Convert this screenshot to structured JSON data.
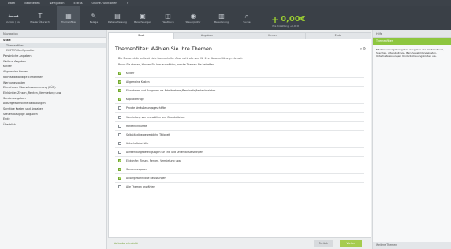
{
  "menu": [
    "Datei",
    "Bearbeiten",
    "Navigation",
    "Extras",
    "Online-Funktionen",
    "?"
  ],
  "toolbar": {
    "items": [
      {
        "icon": "back-forward-icon",
        "glyph": "←→",
        "label": "zurück / vor"
      },
      {
        "icon": "text-icon",
        "glyph": "T",
        "label": "Wieder Übersicht"
      },
      {
        "icon": "filter-icon",
        "glyph": "▦",
        "label": "Themenfilter"
      },
      {
        "icon": "edit-icon",
        "glyph": "✎",
        "label": "Belege"
      },
      {
        "icon": "document-icon",
        "glyph": "▤",
        "label": "Datenerfassung"
      },
      {
        "icon": "calculator-icon",
        "glyph": "▣",
        "label": "Berechnungen"
      },
      {
        "icon": "book-icon",
        "glyph": "◫",
        "label": "Handbuch"
      },
      {
        "icon": "eye-icon",
        "glyph": "◉",
        "label": "Steuerprüfer"
      },
      {
        "icon": "form-icon",
        "glyph": "▥",
        "label": "Berechnung"
      },
      {
        "icon": "search-icon",
        "glyph": "⌕",
        "label": "Suche"
      }
    ],
    "amount_sign": "+",
    "amount_value": "0,00€",
    "amount_sub": "Ihre Erstattung: +0,00 €"
  },
  "leftnav": {
    "title": "Navigation",
    "items": [
      {
        "label": "Start",
        "level": 0,
        "strong": true,
        "selected": false
      },
      {
        "label": "Themenfilter",
        "level": 1,
        "strong": false,
        "selected": true
      },
      {
        "label": "ELSTER-Konfiguration",
        "level": 1,
        "strong": false,
        "selected": false
      },
      {
        "label": "Persönliche Angaben",
        "level": 0,
        "strong": false,
        "selected": false
      },
      {
        "label": "Weitere Angaben",
        "level": 0,
        "strong": false,
        "selected": false
      },
      {
        "label": "Kinder",
        "level": 0,
        "strong": false,
        "selected": false
      },
      {
        "label": "Allgemeine Kosten",
        "level": 0,
        "strong": false,
        "selected": false
      },
      {
        "label": "Nichtselbständige Einnahmen",
        "level": 0,
        "strong": false,
        "selected": false
      },
      {
        "label": "Werbungskosten",
        "level": 0,
        "strong": false,
        "selected": false
      },
      {
        "label": "Einnahmen Überschussrechnung (EÜR)",
        "level": 0,
        "strong": false,
        "selected": false
      },
      {
        "label": "Einkünfte: Zinsen, Renten, Vermietung usw.",
        "level": 0,
        "strong": false,
        "selected": false
      },
      {
        "label": "Sonderausgaben",
        "level": 0,
        "strong": false,
        "selected": false
      },
      {
        "label": "Außergewöhnliche Belastungen",
        "level": 0,
        "strong": false,
        "selected": false
      },
      {
        "label": "Sonstige Kosten und Angaben",
        "level": 0,
        "strong": false,
        "selected": false
      },
      {
        "label": "Steuerabzüglige Abgaben",
        "level": 0,
        "strong": false,
        "selected": false
      },
      {
        "label": "Ende",
        "level": 0,
        "strong": false,
        "selected": false
      },
      {
        "label": "Überblick",
        "level": 0,
        "strong": false,
        "selected": false
      }
    ]
  },
  "tabs": [
    "Start",
    "Angaben",
    "Kinder",
    "Ende"
  ],
  "main": {
    "title": "Themenfilter: Wählen Sie Ihre Themen",
    "controls": "⌕ ⚙",
    "desc1": "Die Steuererklär umfasst viele Sachverhalte. Aber nicht alle sind für Ihre Steuererklärung relevant.",
    "desc2": "Bevor Sie starten, können Sie hier auswählen, welche Themen Sie betreffen.",
    "rows": [
      {
        "label": "Kinder",
        "checked": true
      },
      {
        "label": "Allgemeine Kosten",
        "checked": true
      },
      {
        "label": "Einnahmen und Ausgaben als Arbeitnehmer/Pensionär/Rentenbezieher",
        "checked": true
      },
      {
        "label": "Kapitalerträge",
        "checked": true
      },
      {
        "label": "Private Veräußerungsgeschäfte",
        "checked": false
      },
      {
        "label": "Vermietung von Immobilien und Grundstücken",
        "checked": false
      },
      {
        "label": "Renteneinkünfte",
        "checked": false
      },
      {
        "label": "Selbständige/gewerbliche Tätigkeit",
        "checked": false
      },
      {
        "label": "Unterhaltsbeihilfe",
        "checked": false
      },
      {
        "label": "Aufwendungsbeteiligungen für Ehe und Unterhaltsleistungen",
        "checked": false
      },
      {
        "label": "Einkünfte: Zinsen, Renten, Vermietung usw.",
        "checked": true
      },
      {
        "label": "Sonderausgaben",
        "checked": true
      },
      {
        "label": "Außergewöhnliche Belastungen",
        "checked": true
      },
      {
        "label": "Alle Themen anwählen",
        "checked": false
      }
    ]
  },
  "bottom": {
    "link": "Vorlaube ein-nicht",
    "back": "Zurück",
    "next": "Weiter"
  },
  "rightpanel": {
    "title": "Hilfe",
    "green_label": "Themenfilter",
    "text": "Mit Sonderausgaben geben Ausgaben wie Kirchensteuer, Spenden, Altersbeiträge, Berufsausbildungskosten, Unterhaltsleistungen, Kinderbetreuungskosten u.a.",
    "footer": "Weitere Themen"
  }
}
